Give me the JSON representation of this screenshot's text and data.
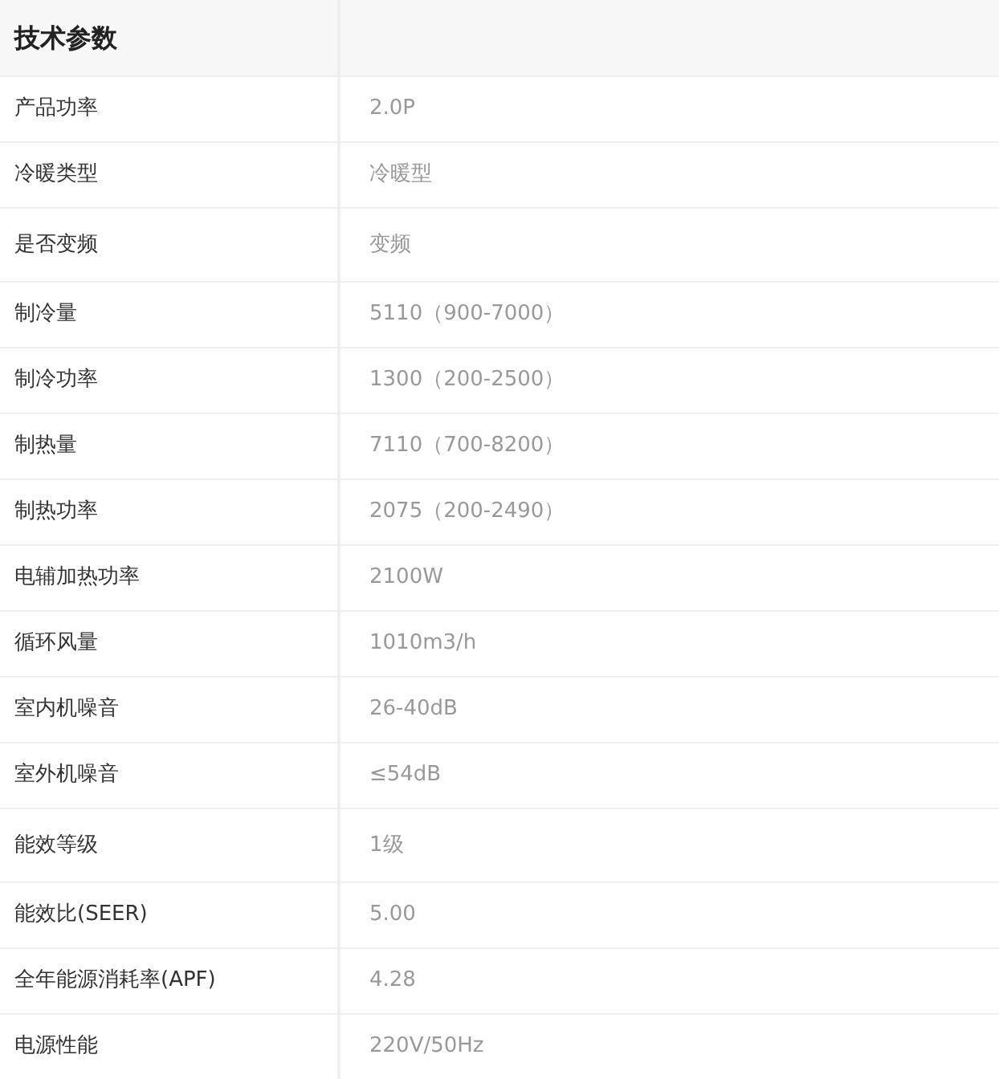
{
  "table": {
    "title": "技术参数",
    "rows": [
      {
        "label": "产品功率",
        "value": "2.0P"
      },
      {
        "label": "冷暖类型",
        "value": "冷暖型"
      },
      {
        "label": "是否变频",
        "value": "变频"
      },
      {
        "label": "制冷量",
        "value": "5110（900-7000）"
      },
      {
        "label": "制冷功率",
        "value": "1300（200-2500）"
      },
      {
        "label": "制热量",
        "value": "7110（700-8200）"
      },
      {
        "label": "制热功率",
        "value": "2075（200-2490）"
      },
      {
        "label": "电辅加热功率",
        "value": "2100W"
      },
      {
        "label": "循环风量",
        "value": "1010m3/h"
      },
      {
        "label": "室内机噪音",
        "value": "26-40dB"
      },
      {
        "label": "室外机噪音",
        "value": "≤54dB"
      },
      {
        "label": "能效等级",
        "value": "1级"
      },
      {
        "label": "能效比(SEER)",
        "value": "5.00"
      },
      {
        "label": "全年能源消耗率(APF)",
        "value": "4.28"
      },
      {
        "label": "电源性能",
        "value": "220V/50Hz"
      }
    ]
  }
}
